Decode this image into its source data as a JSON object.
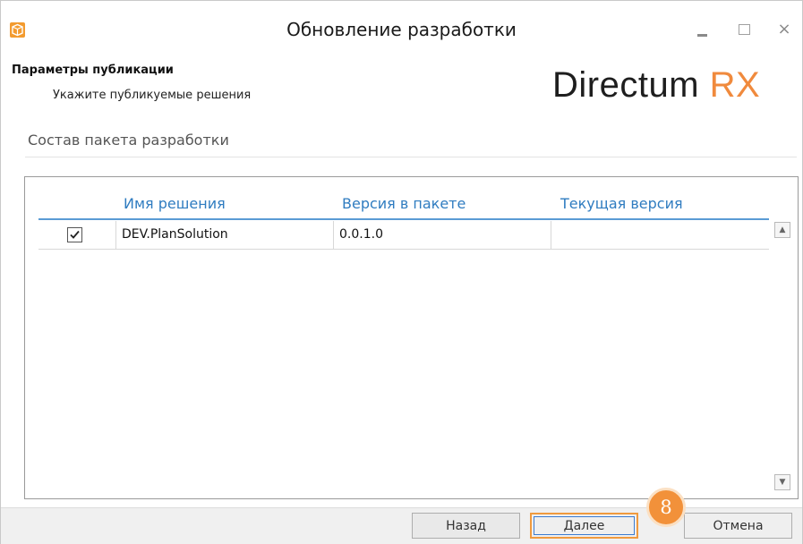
{
  "window": {
    "title": "Обновление разработки",
    "icon": "package-box-icon",
    "controls": {
      "minimize": "minimize-icon",
      "maximize": "maximize-icon",
      "close_glyph": "×"
    }
  },
  "header": {
    "title": "Параметры публикации",
    "subtitle": "Укажите публикуемые решения",
    "logo": {
      "main": "Directum ",
      "accent": "RX",
      "accent_color": "#f08a3d"
    }
  },
  "section": {
    "label": "Состав пакета разработки"
  },
  "table": {
    "columns": [
      "Имя решения",
      "Версия в пакете",
      "Текущая версия"
    ],
    "rows": [
      {
        "checked": true,
        "name": "DEV.PlanSolution",
        "package_version": "0.0.1.0",
        "current_version": ""
      }
    ]
  },
  "scrollbar": {
    "up": "▲",
    "down": "▼"
  },
  "buttons": {
    "back": "Назад",
    "next": "Далее",
    "cancel": "Отмена"
  },
  "callout": {
    "number": "8",
    "color": "#f2913a"
  }
}
